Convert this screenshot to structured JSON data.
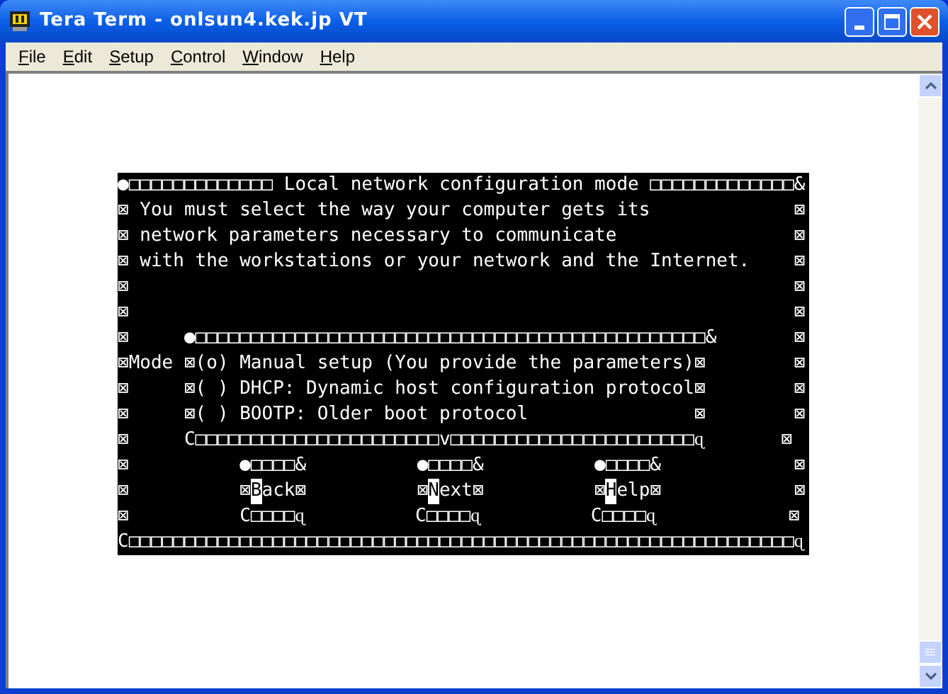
{
  "window": {
    "title": "Tera Term - onlsun4.kek.jp VT"
  },
  "menu": [
    {
      "label": "File"
    },
    {
      "label": "Edit"
    },
    {
      "label": "Setup"
    },
    {
      "label": "Control"
    },
    {
      "label": "Window"
    },
    {
      "label": "Help"
    }
  ],
  "terminal": {
    "lines": [
      {
        "text": "●□□□□□□□□□□□□□ Local network configuration mode □□□□□□□□□□□□□&"
      },
      {
        "text": "⊠ You must select the way your computer gets its             ⊠"
      },
      {
        "text": "⊠ network parameters necessary to communicate                ⊠"
      },
      {
        "text": "⊠ with the workstations or your network and the Internet.    ⊠"
      },
      {
        "text": "⊠                                                            ⊠"
      },
      {
        "text": "⊠                                                            ⊠"
      },
      {
        "text": "⊠     ●□□□□□□□□□□□□□□□□□□□□□□□□□□□□□□□□□□□□□□□□□□□□□□&       ⊠"
      },
      {
        "text": "⊠Mode ⊠(o) Manual setup (You provide the parameters)⊠        ⊠"
      },
      {
        "text": "⊠     ⊠( ) DHCP: Dynamic host configuration protocol⊠        ⊠"
      },
      {
        "text": "⊠     ⊠( ) BOOTP: Older boot protocol               ⊠        ⊠"
      },
      {
        "text": "⊠     C□□□□□□□□□□□□□□□□□□□□□□v□□□□□□□□□□□□□□□□□□□□□□ɋ       ⊠"
      },
      {
        "text": "⊠          ●□□□□&          ●□□□□&          ●□□□□&            ⊠"
      },
      {
        "segments": [
          {
            "text": "⊠          ⊠",
            "inverse": false
          },
          {
            "text": "B",
            "inverse": true
          },
          {
            "text": "ack⊠          ⊠",
            "inverse": false
          },
          {
            "text": "N",
            "inverse": true
          },
          {
            "text": "ext⊠          ⊠",
            "inverse": false
          },
          {
            "text": "H",
            "inverse": true
          },
          {
            "text": "elp⊠            ⊠",
            "inverse": false
          }
        ]
      },
      {
        "text": "⊠          C□□□□ɋ          C□□□□ɋ          C□□□□ɋ            ⊠"
      },
      {
        "text": "C□□□□□□□□□□□□□□□□□□□□□□□□□□□□□□□□□□□□□□□□□□□□□□□□□□□□□□□□□□□□ɋ"
      }
    ]
  }
}
